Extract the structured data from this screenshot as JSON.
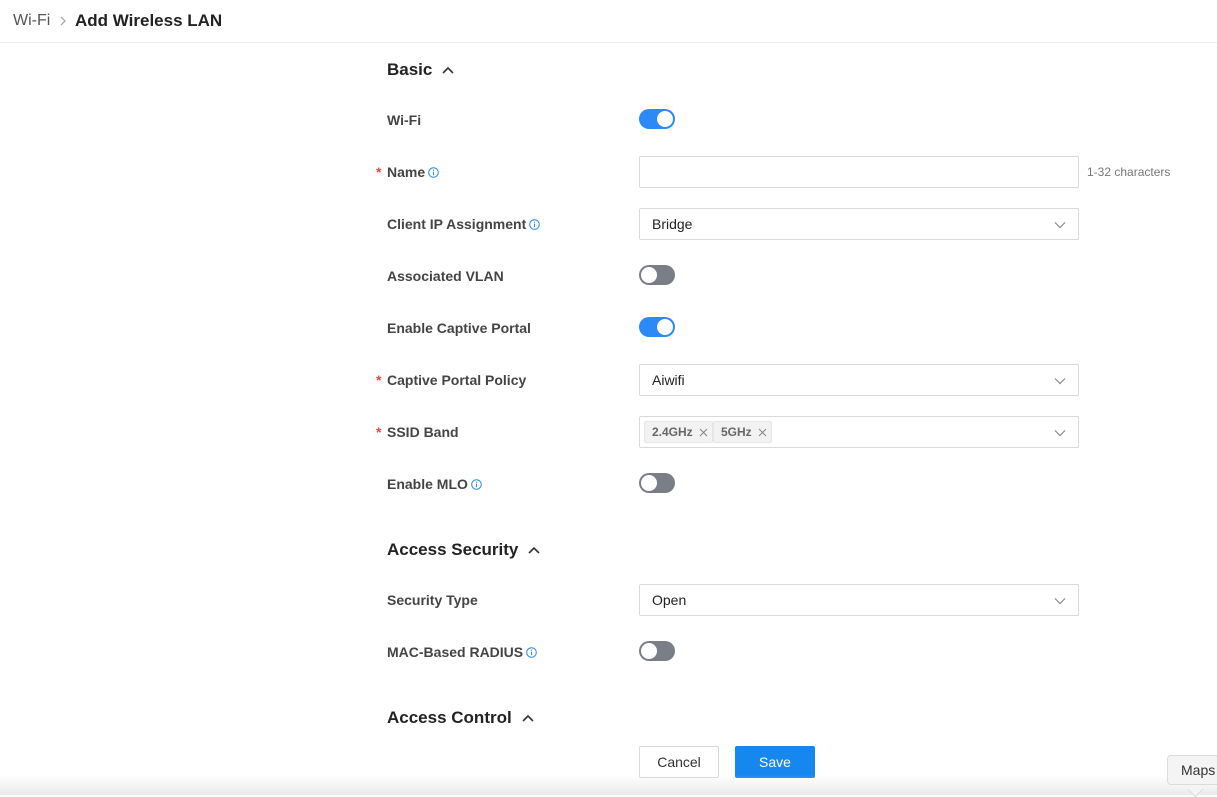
{
  "breadcrumb": {
    "parent": "Wi-Fi",
    "current": "Add Wireless LAN"
  },
  "sections": {
    "basic": "Basic",
    "access_security": "Access Security",
    "access_control": "Access Control"
  },
  "basic": {
    "wifi": {
      "label": "Wi-Fi",
      "enabled": true
    },
    "name": {
      "label": "Name",
      "required": true,
      "value": "",
      "placeholder": "",
      "hint": "1-32 characters"
    },
    "client_ip_assignment": {
      "label": "Client IP Assignment",
      "value": "Bridge"
    },
    "associated_vlan": {
      "label": "Associated VLAN",
      "enabled": false
    },
    "enable_captive_portal": {
      "label": "Enable Captive Portal",
      "enabled": true
    },
    "captive_portal_policy": {
      "label": "Captive Portal Policy",
      "required": true,
      "value": "Aiwifi"
    },
    "ssid_band": {
      "label": "SSID Band",
      "required": true,
      "tags": [
        "2.4GHz",
        "5GHz"
      ]
    },
    "enable_mlo": {
      "label": "Enable MLO",
      "enabled": false
    }
  },
  "access_security": {
    "security_type": {
      "label": "Security Type",
      "value": "Open"
    },
    "mac_based_radius": {
      "label": "MAC-Based RADIUS",
      "enabled": false
    }
  },
  "actions": {
    "cancel": "Cancel",
    "save": "Save"
  },
  "maps_tab": "Maps",
  "colors": {
    "accent": "#1787f0",
    "toggle_on": "#2b8af7",
    "toggle_off": "#7a7f87",
    "required": "#f04545"
  }
}
